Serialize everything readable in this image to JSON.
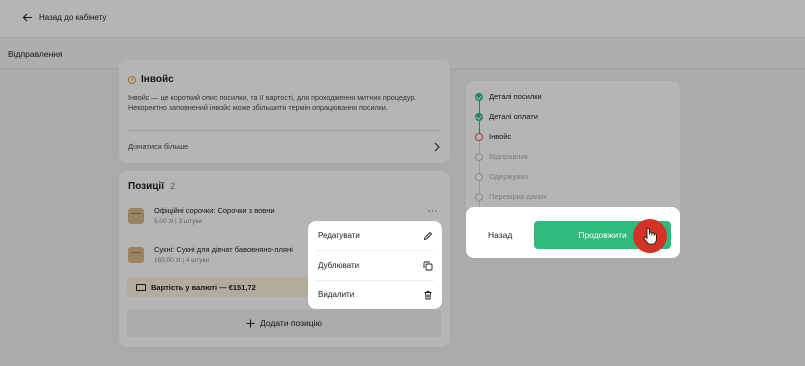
{
  "topbar": {
    "back_label": "Назад до кабінету"
  },
  "subbar": {
    "title": "Відправлення"
  },
  "invoice": {
    "title": "Інвойс",
    "description": "Інвойс — це короткий опис посилки, та її вартості, для проходження митних процедур. Некоректно заповнений інвойс може збільшити термін опрацювання посилки.",
    "learn_more": "Дізнатися більше"
  },
  "positions": {
    "title": "Позиції",
    "count": "2",
    "items": [
      {
        "name": "Офіційні сорочки: Сорочки з вовни",
        "price": "5,00 zł",
        "qty": "3 штуки"
      },
      {
        "name": "Сукні: Сукні для дівчат бавовняно-лляні",
        "price": "160,00 zł",
        "qty": "4 штуки"
      }
    ],
    "cost_label": "Вартість у валюті — €151,72",
    "add_label": "Додати позицію",
    "more_glyph": "⋯"
  },
  "steps": [
    {
      "label": "Деталі посилки",
      "state": "done"
    },
    {
      "label": "Деталі оплати",
      "state": "done"
    },
    {
      "label": "Інвойс",
      "state": "active"
    },
    {
      "label": "Відправник",
      "state": "todo"
    },
    {
      "label": "Одержувач",
      "state": "todo"
    },
    {
      "label": "Перевірка даних",
      "state": "todo"
    }
  ],
  "footer": {
    "back_label": "Назад",
    "next_label": "Продовжити"
  },
  "context_menu": {
    "edit": "Редагувати",
    "duplicate": "Дублювати",
    "delete": "Видалити"
  },
  "colors": {
    "accent": "#2fb97a",
    "warning": "#e0a21e",
    "active_step": "#e05a5a",
    "cursor_badge": "#d33227"
  }
}
